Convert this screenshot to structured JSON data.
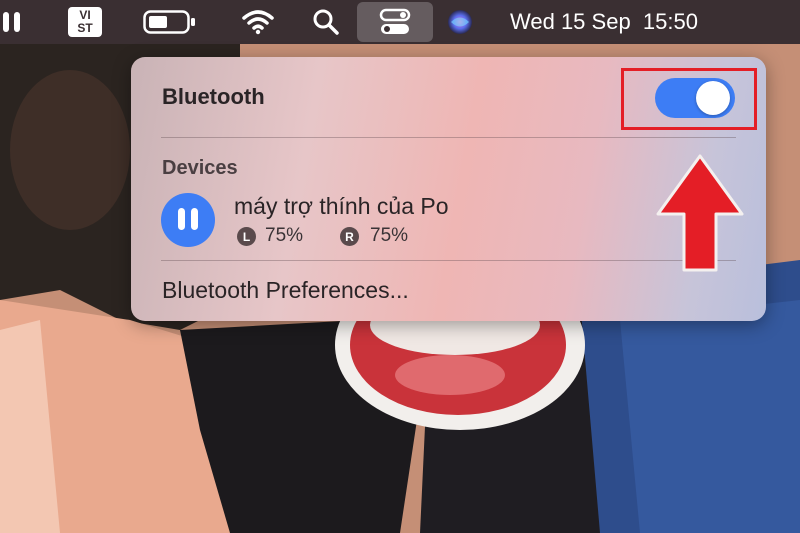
{
  "menubar": {
    "input_source": "VI\nST",
    "clock": "Wed 15 Sep  15:50",
    "icons": [
      "airpods-icon",
      "input-source-icon",
      "battery-icon",
      "wifi-icon",
      "search-icon",
      "control-center-icon",
      "siri-icon"
    ]
  },
  "panel": {
    "title": "Bluetooth",
    "toggle_on": true,
    "section_label": "Devices",
    "devices": [
      {
        "name": "máy trợ thính của Po",
        "left_badge": "L",
        "left_level": "75%",
        "right_badge": "R",
        "right_level": "75%"
      }
    ],
    "preferences_label": "Bluetooth Preferences..."
  },
  "colors": {
    "toggle": "#3d7df5",
    "highlight": "#e41e26",
    "arrow": "#e41e26",
    "menubar": "#3a2f32"
  }
}
